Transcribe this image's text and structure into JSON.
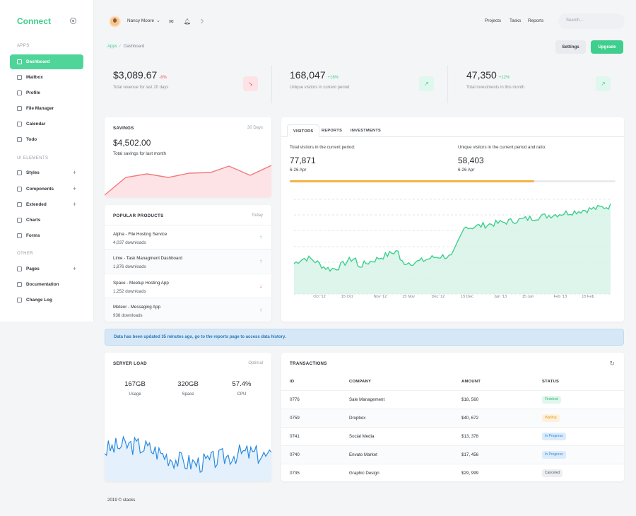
{
  "brand": "Connect",
  "sidebar": {
    "sections": [
      "APPS",
      "UI ELEMENTS",
      "OTHER"
    ],
    "items": [
      {
        "label": "Dashboard",
        "icon": "grid-icon",
        "active": true
      },
      {
        "label": "Mailbox",
        "icon": "mail-icon"
      },
      {
        "label": "Profile",
        "icon": "user-icon"
      },
      {
        "label": "File Manager",
        "icon": "cloud-icon"
      },
      {
        "label": "Calendar",
        "icon": "calendar-icon"
      },
      {
        "label": "Todo",
        "icon": "check-icon"
      },
      {
        "label": "Styles",
        "icon": "drop-icon",
        "expand": true
      },
      {
        "label": "Components",
        "icon": "grid-icon",
        "expand": true
      },
      {
        "label": "Extended",
        "icon": "layers-icon",
        "expand": true
      },
      {
        "label": "Charts",
        "icon": "chart-icon"
      },
      {
        "label": "Forms",
        "icon": "form-icon"
      },
      {
        "label": "Pages",
        "icon": "star-icon",
        "expand": true
      },
      {
        "label": "Documentation",
        "icon": "book-icon"
      },
      {
        "label": "Change Log",
        "icon": "clock-icon"
      }
    ]
  },
  "topbar": {
    "user": "Nancy Moore",
    "links": [
      "Projects",
      "Tasks",
      "Reports"
    ],
    "search_placeholder": "Search..."
  },
  "breadcrumb": {
    "root": "Apps",
    "current": "Dashboard"
  },
  "buttons": {
    "settings": "Settings",
    "upgrade": "Upgrade"
  },
  "stats": [
    {
      "value": "$3,089.67",
      "delta": "-8%",
      "label": "Total revenue for last 20 days",
      "trend": "down"
    },
    {
      "value": "168,047",
      "delta": "+16%",
      "label": "Unique visitors in current period",
      "trend": "up"
    },
    {
      "value": "47,350",
      "delta": "+12%",
      "label": "Total investments in this month",
      "trend": "up"
    }
  ],
  "savings": {
    "title": "SAVINGS",
    "period": "30 Days",
    "value": "$4,502.00",
    "label": "Total savings for last month"
  },
  "products": {
    "title": "POPULAR PRODUCTS",
    "period": "Today",
    "items": [
      {
        "name": "Alpha - File Hosting Service",
        "count": "4,037 downloads",
        "trend": "up"
      },
      {
        "name": "Lime - Task Managment Dashboard",
        "count": "1,876 downloads",
        "trend": "up"
      },
      {
        "name": "Space - Meetup Hosting App",
        "count": "1,252 downloads",
        "trend": "down"
      },
      {
        "name": "Meteor - Messaging App",
        "count": "938 downloads",
        "trend": "up"
      }
    ]
  },
  "visitors": {
    "tabs": [
      "VISITORS",
      "REPORTS",
      "INVESTMENTS"
    ],
    "total_label": "Total visitors in the current period:",
    "total_value": "77,871",
    "total_range": "6-26 Apr",
    "unique_label": "Unique visitors in the current period and ratio:",
    "unique_value": "58,403",
    "unique_range": "6-26 Apr",
    "progress": 0.75,
    "xticks": [
      "Oct '12",
      "15 Oct",
      "Nov '12",
      "15 Nov",
      "Dec '12",
      "15 Dec",
      "Jan '13",
      "15 Jan",
      "Feb '13",
      "15 Feb"
    ]
  },
  "alert": "Data has been updated 35 minutes ago, go to the reports page to access data history.",
  "server": {
    "title": "SERVER LOAD",
    "status": "Optimal",
    "metrics": [
      {
        "value": "167GB",
        "label": "Usage"
      },
      {
        "value": "320GB",
        "label": "Space"
      },
      {
        "value": "57.4%",
        "label": "CPU"
      }
    ]
  },
  "transactions": {
    "title": "TRANSACTIONS",
    "headers": [
      "ID",
      "COMPANY",
      "AMOUNT",
      "STATUS"
    ],
    "rows": [
      {
        "id": "0776",
        "company": "Sale Management",
        "amount": "$18, 560",
        "status": "Finished"
      },
      {
        "id": "0759",
        "company": "Dropbox",
        "amount": "$40, 672",
        "status": "Waiting"
      },
      {
        "id": "0741",
        "company": "Social Media",
        "amount": "$13, 378",
        "status": "In Progress"
      },
      {
        "id": "0740",
        "company": "Envato Market",
        "amount": "$17, 456",
        "status": "In Progress"
      },
      {
        "id": "0735",
        "company": "Graphic Design",
        "amount": "$29, 999",
        "status": "Canceled"
      }
    ]
  },
  "footer": "2019 © stacks",
  "colors": {
    "accent": "#3ecf8e",
    "danger": "#f05a64",
    "warning": "#f5b342",
    "info": "#2b8ae0"
  }
}
